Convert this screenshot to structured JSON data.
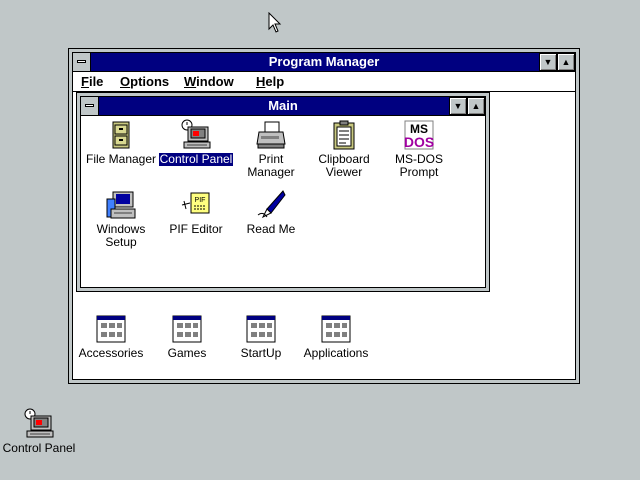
{
  "program_manager": {
    "title": "Program Manager",
    "menu": [
      "File",
      "Options",
      "Window",
      "Help"
    ],
    "minimize_glyph": "▼",
    "maximize_glyph": "▲"
  },
  "main_group": {
    "title": "Main",
    "icons": [
      {
        "label": "File Manager",
        "icon": "file-cabinet-icon"
      },
      {
        "label": "Control Panel",
        "icon": "control-panel-icon",
        "selected": true
      },
      {
        "label": "Print Manager",
        "icon": "printer-icon"
      },
      {
        "label": "Clipboard\nViewer",
        "icon": "clipboard-icon"
      },
      {
        "label": "MS-DOS\nPrompt",
        "icon": "ms-dos-icon"
      },
      {
        "label": "Windows\nSetup",
        "icon": "windows-setup-icon"
      },
      {
        "label": "PIF Editor",
        "icon": "pif-editor-icon"
      },
      {
        "label": "Read Me",
        "icon": "read-me-icon"
      }
    ]
  },
  "group_icons": [
    {
      "label": "Accessories",
      "icon": "program-group-icon"
    },
    {
      "label": "Games",
      "icon": "program-group-icon"
    },
    {
      "label": "StartUp",
      "icon": "program-group-icon"
    },
    {
      "label": "Applications",
      "icon": "program-group-icon"
    }
  ],
  "desktop": {
    "minimized_icon": {
      "label": "Control Panel",
      "icon": "control-panel-icon"
    }
  },
  "colors": {
    "desktop": "#c0c7c8",
    "titlebar_active": "#000080",
    "window": "#ffffff"
  }
}
